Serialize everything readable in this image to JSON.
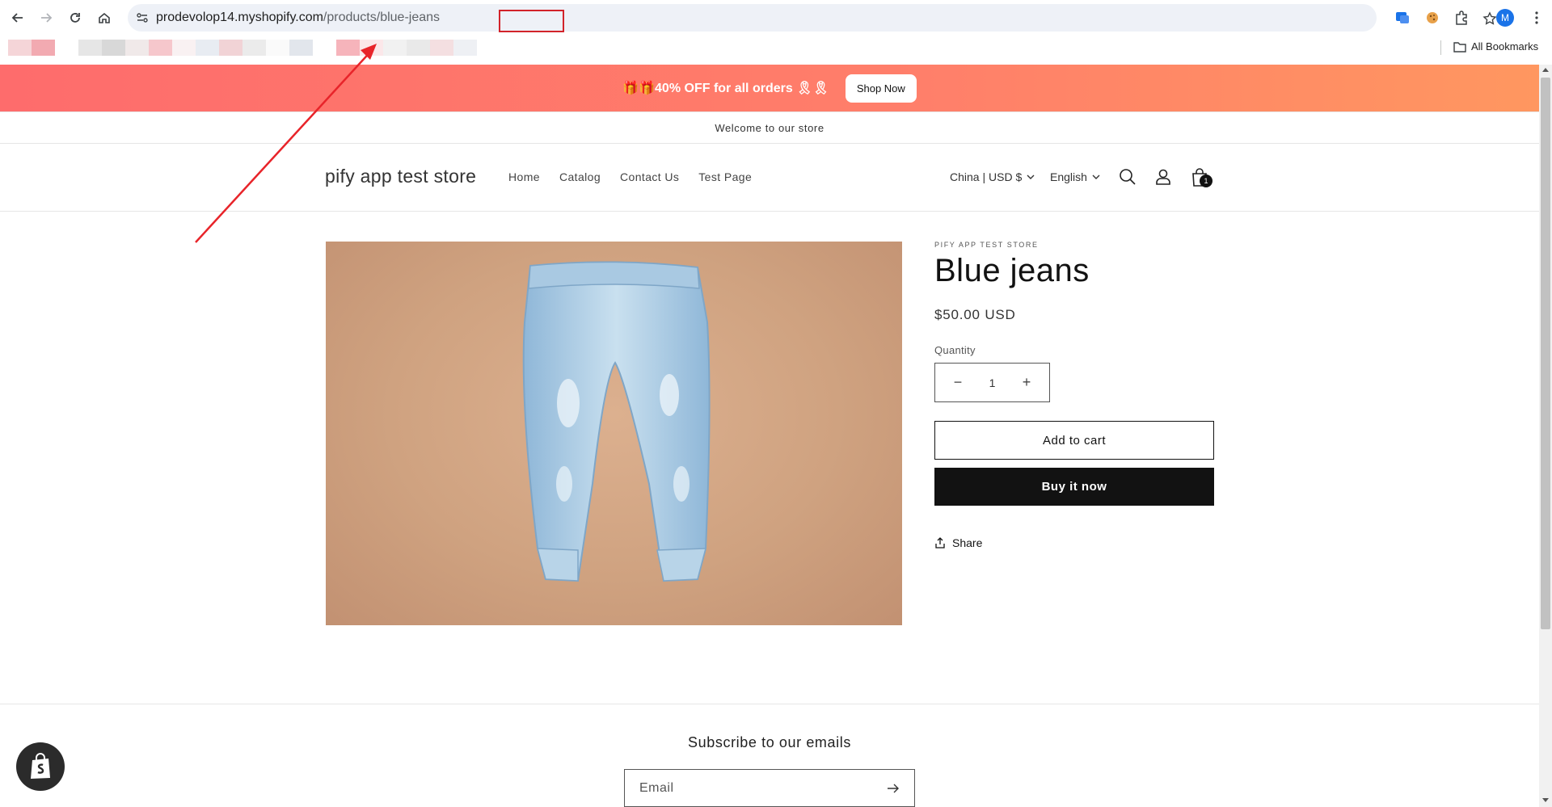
{
  "browser": {
    "url_domain": "prodevolop14.myshopify.com",
    "url_path": "/products/",
    "url_slug": "blue-jeans",
    "profile_initial": "M",
    "all_bookmarks": "All Bookmarks"
  },
  "promo": {
    "text": "🎁🎁40% OFF for all orders 🎗🎗",
    "button": "Shop Now"
  },
  "announcement": "Welcome to our store",
  "header": {
    "logo": "pify app test store",
    "nav": [
      "Home",
      "Catalog",
      "Contact Us",
      "Test Page"
    ],
    "country": "China | USD $",
    "language": "English",
    "cart_count": "1"
  },
  "product": {
    "vendor": "PIFY APP TEST STORE",
    "title": "Blue jeans",
    "price": "$50.00 USD",
    "quantity_label": "Quantity",
    "quantity": "1",
    "add_to_cart": "Add to cart",
    "buy_now": "Buy it now",
    "share": "Share"
  },
  "footer": {
    "subscribe_title": "Subscribe to our emails",
    "email_placeholder": "Email"
  },
  "colors": {
    "annotation_red": "#d2232a",
    "promo_start": "#fe6c6c",
    "promo_end": "#ff9760"
  }
}
